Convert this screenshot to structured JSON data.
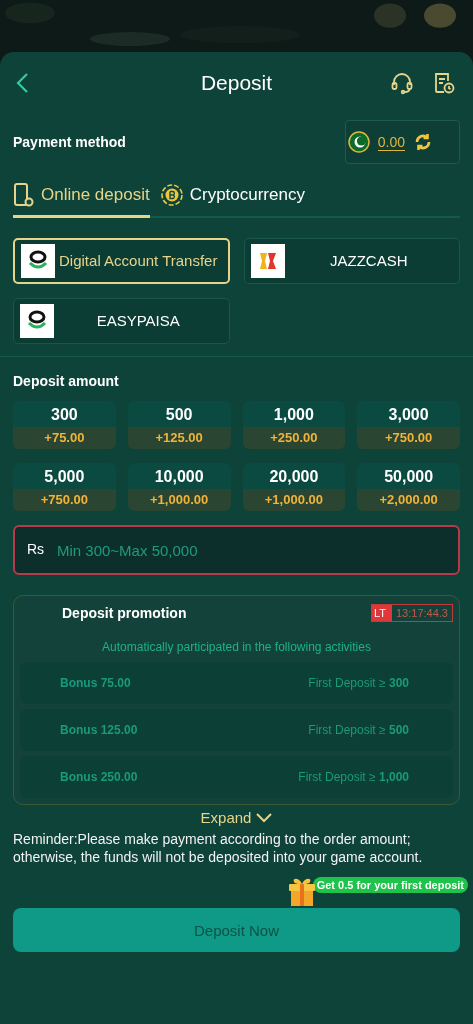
{
  "header": {
    "title": "Deposit"
  },
  "payment_method": {
    "label": "Payment method",
    "balance": "0.00"
  },
  "tabs": [
    {
      "label": "Online deposit",
      "selected": true,
      "kind": "phone"
    },
    {
      "label": "Cryptocurrency",
      "selected": false,
      "kind": "coin"
    }
  ],
  "methods": [
    {
      "label": "Digital Account Transfer",
      "selected": true,
      "kind": "ring"
    },
    {
      "label": "JAZZCASH",
      "selected": false,
      "kind": "jazz"
    },
    {
      "label": "EASYPAISA",
      "selected": false,
      "kind": "ring"
    }
  ],
  "deposit_amount": {
    "label": "Deposit amount",
    "amounts": [
      {
        "amount": "300",
        "bonus": "+75.00"
      },
      {
        "amount": "500",
        "bonus": "+125.00"
      },
      {
        "amount": "1,000",
        "bonus": "+250.00"
      },
      {
        "amount": "3,000",
        "bonus": "+750.00"
      },
      {
        "amount": "5,000",
        "bonus": "+750.00"
      },
      {
        "amount": "10,000",
        "bonus": "+1,000.00"
      },
      {
        "amount": "20,000",
        "bonus": "+1,000.00"
      },
      {
        "amount": "50,000",
        "bonus": "+2,000.00"
      }
    ],
    "currency": "Rs",
    "placeholder": "Min 300~Max 50,000"
  },
  "promotion": {
    "title": "Deposit promotion",
    "timer_tag": "LT",
    "timer": "13:17:44.3",
    "subtitle": "Automatically participated in the following activities",
    "rows": [
      {
        "bonus": "Bonus 75.00",
        "condition": "First Deposit ≥ **300**"
      },
      {
        "bonus": "Bonus 125.00",
        "condition": "First Deposit ≥ **500**"
      },
      {
        "bonus": "Bonus 250.00",
        "condition": "First Deposit ≥ **1,000**"
      }
    ],
    "expand": "Expand"
  },
  "reminder": "Reminder:Please make payment according to the order amount; otherwise, the funds will not be deposited into your game account.",
  "gift_badge": "Get 0.5 for your first deposit",
  "submit": {
    "label": "Deposit Now",
    "disabled": true
  }
}
